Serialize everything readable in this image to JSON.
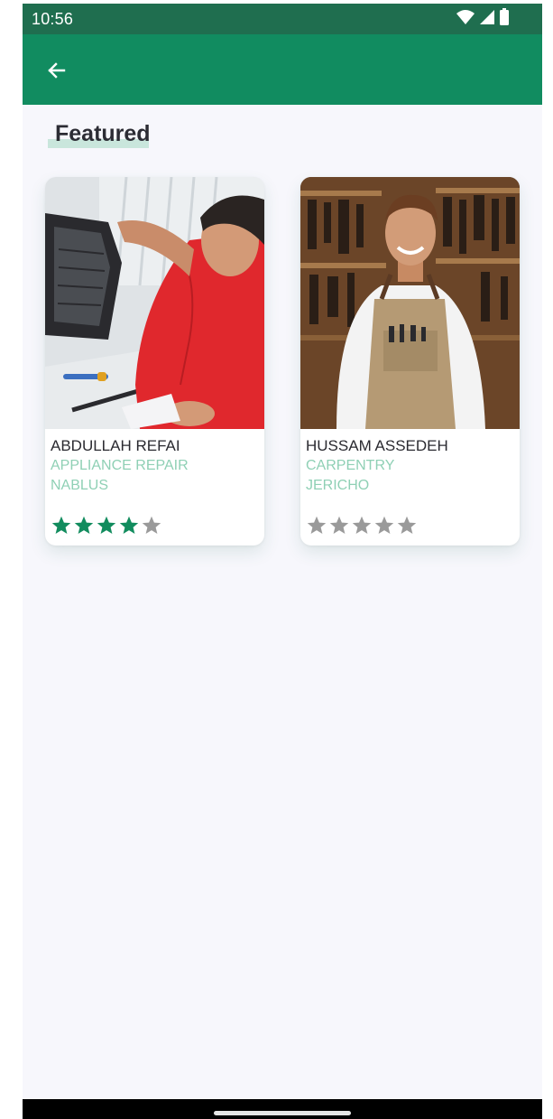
{
  "status_bar": {
    "time": "10:56",
    "icons": [
      "wifi-icon",
      "cellular-signal-icon",
      "battery-icon"
    ]
  },
  "app_bar": {
    "back_icon": "arrow-left-icon"
  },
  "section": {
    "title": "Featured"
  },
  "colors": {
    "status_bar": "#1f6e4f",
    "app_bar": "#118c60",
    "accent_text": "#8fd0b5",
    "star_filled": "#128c5e",
    "star_empty": "#9a9a9a",
    "background": "#f7f7fc"
  },
  "cards": [
    {
      "name": "ABDULLAH REFAI",
      "category": "APPLIANCE REPAIR",
      "city": "NABLUS",
      "rating": 4,
      "rating_max": 5,
      "photo": "technician repairing appliance"
    },
    {
      "name": "HUSSAM ASSEDEH",
      "category": "CARPENTRY",
      "city": "JERICHO",
      "rating": 0,
      "rating_max": 5,
      "photo": "carpenter in workshop"
    }
  ]
}
